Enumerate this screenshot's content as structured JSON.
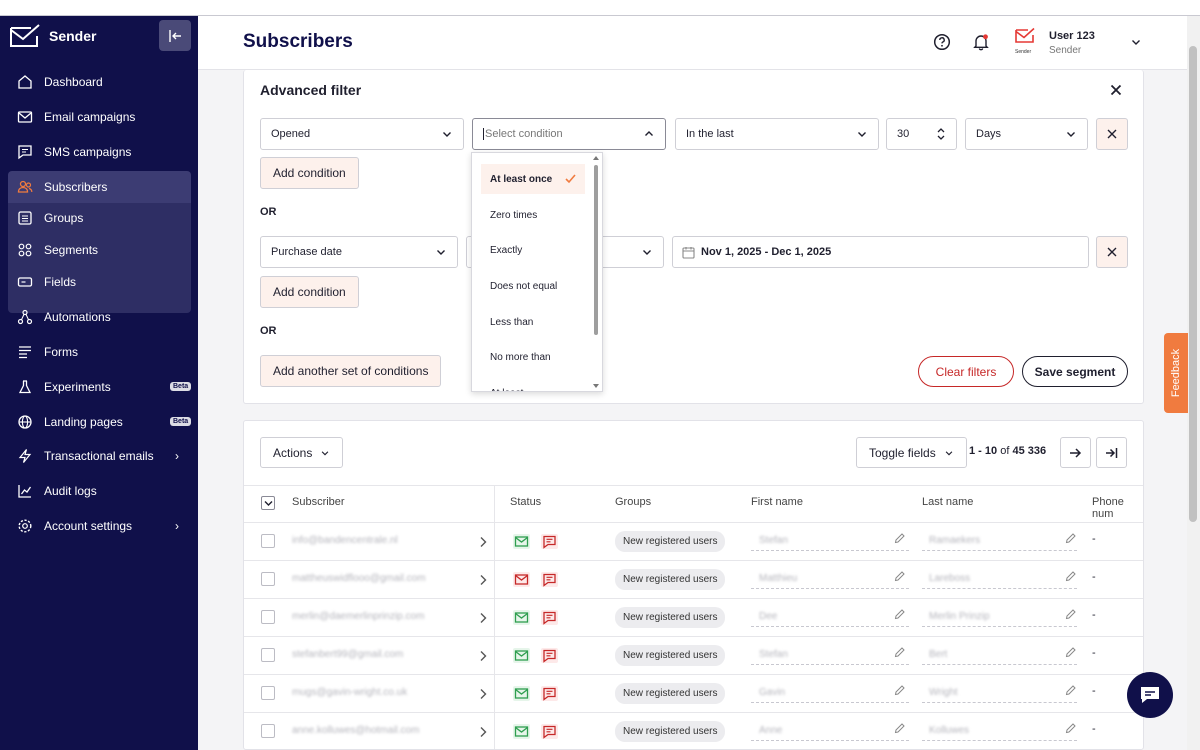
{
  "brand": {
    "name": "Sender"
  },
  "sidebar": {
    "items": [
      {
        "label": "Dashboard"
      },
      {
        "label": "Email campaigns"
      },
      {
        "label": "SMS campaigns"
      },
      {
        "label": "Subscribers"
      },
      {
        "label": "Groups"
      },
      {
        "label": "Segments"
      },
      {
        "label": "Fields"
      },
      {
        "label": "Automations"
      },
      {
        "label": "Forms"
      },
      {
        "label": "Experiments",
        "badge": "Beta"
      },
      {
        "label": "Landing pages",
        "badge": "Beta"
      },
      {
        "label": "Transactional emails"
      },
      {
        "label": "Audit logs"
      },
      {
        "label": "Account settings"
      }
    ]
  },
  "header": {
    "title": "Subscribers",
    "user_name": "User 123",
    "user_role": "Sender",
    "avatar_text": "Sender"
  },
  "filter": {
    "title": "Advanced filter",
    "row1": {
      "field": "Opened",
      "condition_placeholder": "Select condition",
      "period": "In the last",
      "number": "30",
      "unit": "Days"
    },
    "row2": {
      "field": "Purchase date",
      "date_range": "Nov 1, 2025 - Dec 1, 2025"
    },
    "add_condition": "Add condition",
    "or": "OR",
    "add_set": "Add another set of conditions",
    "clear": "Clear filters",
    "save": "Save segment",
    "dropdown_options": [
      "At least once",
      "Zero times",
      "Exactly",
      "Does not equal",
      "Less than",
      "No more than",
      "At least"
    ],
    "dropdown_selected": "At least once"
  },
  "table": {
    "actions": "Actions",
    "toggle_fields": "Toggle fields",
    "pagination": {
      "range": "1 - 10",
      "of": "of",
      "total": "45 336"
    },
    "columns": [
      "Subscriber",
      "Status",
      "Groups",
      "First name",
      "Last name",
      "Phone num"
    ],
    "rows": [
      {
        "email": "info@bandencentrale.nl",
        "group": "New registered users",
        "first": "Stefan",
        "last": "Ramaekers",
        "phone": "-",
        "mail_status": "green"
      },
      {
        "email": "mattheuswidflooo@gmail.com",
        "group": "New registered users",
        "first": "Matthieu",
        "last": "Lareboss",
        "phone": "-",
        "mail_status": "red"
      },
      {
        "email": "merlin@daemerlinprinzip.com",
        "group": "New registered users",
        "first": "Dee",
        "last": "Merlin Prinzip",
        "phone": "-",
        "mail_status": "green"
      },
      {
        "email": "stefanbert99@gmail.com",
        "group": "New registered users",
        "first": "Stefan",
        "last": "Bert",
        "phone": "-",
        "mail_status": "green"
      },
      {
        "email": "mugs@gavin-wright.co.uk",
        "group": "New registered users",
        "first": "Gavin",
        "last": "Wright",
        "phone": "-",
        "mail_status": "green"
      },
      {
        "email": "anne.kolluwes@hotmail.com",
        "group": "New registered users",
        "first": "Anne",
        "last": "Kolluwes",
        "phone": "-",
        "mail_status": "green"
      }
    ]
  },
  "feedback": "Feedback",
  "colors": {
    "sidebar": "#10104a",
    "accent": "#f07b3f",
    "danger": "#c62828",
    "success": "#2e9e4f"
  }
}
